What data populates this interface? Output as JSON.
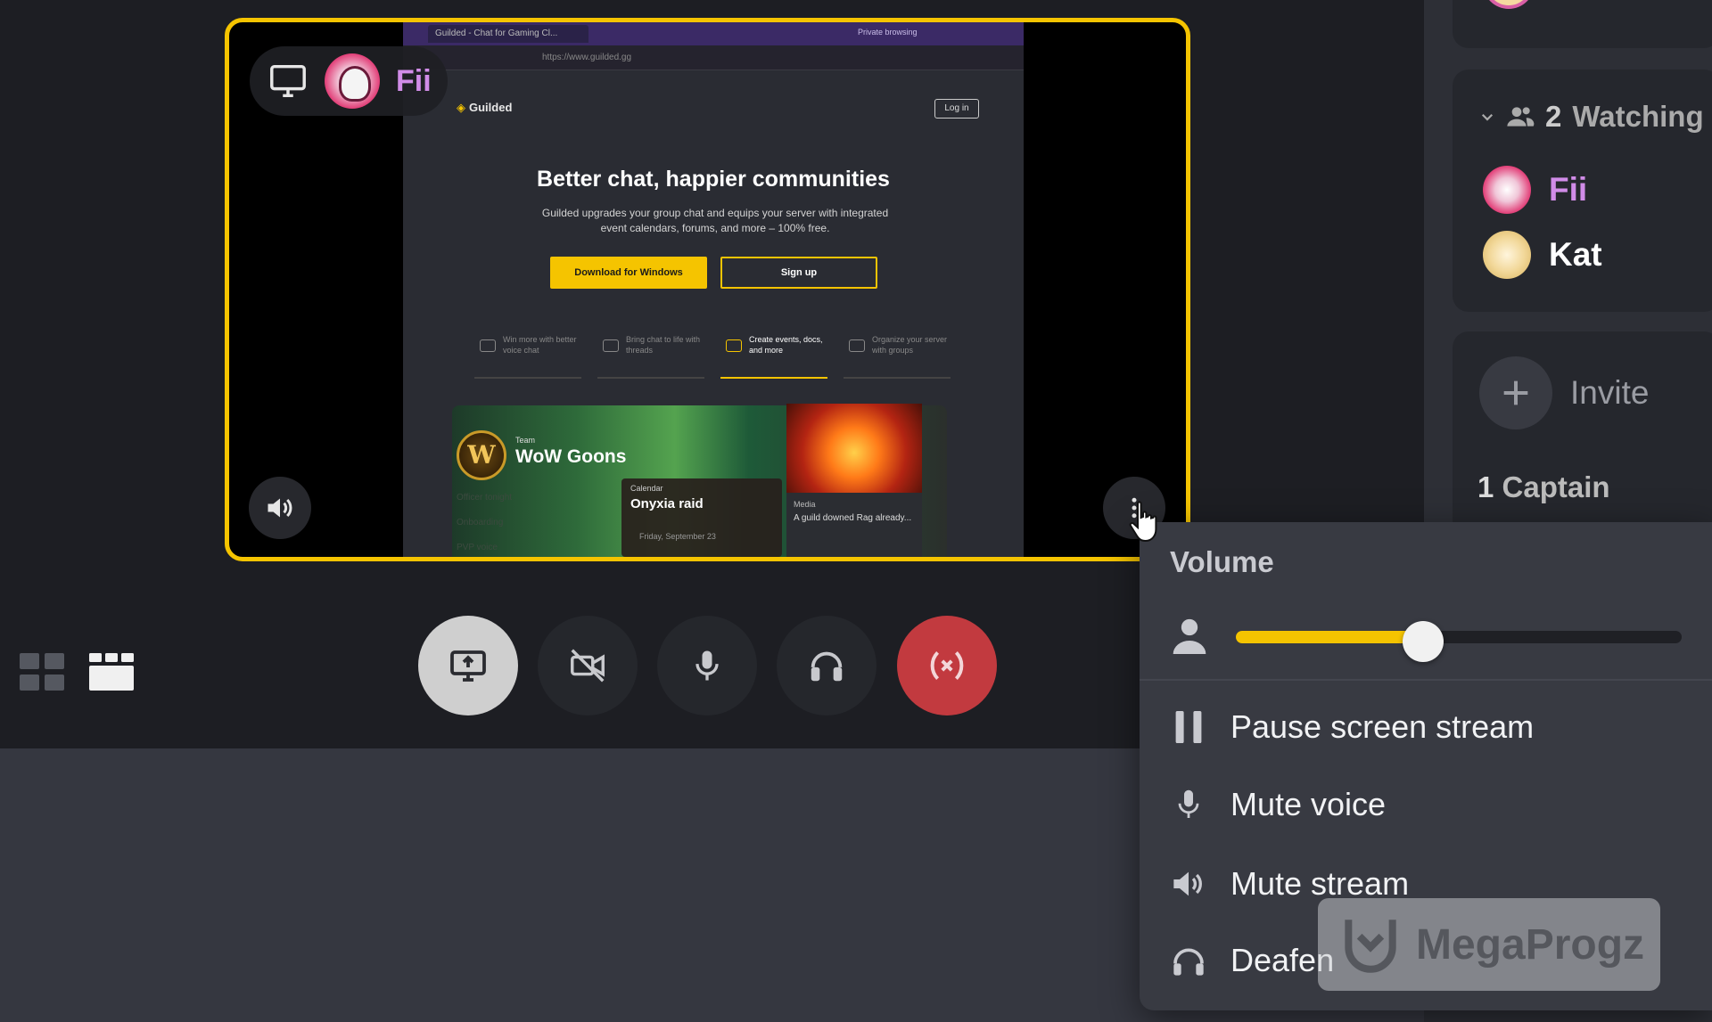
{
  "stream": {
    "streamer_name": "Fii",
    "browser_tab_title": "Guilded - Chat for Gaming Cl...",
    "browser_private_label": "Private browsing",
    "browser_url": "https://www.guilded.gg",
    "site": {
      "logo_text": "Guilded",
      "login_label": "Log in",
      "hero_title": "Better chat, happier communities",
      "hero_subtitle": "Guilded upgrades your group chat and equips your server with integrated event calendars, forums, and more – 100% free.",
      "primary_cta": "Download for Windows",
      "secondary_cta": "Sign up",
      "features": [
        "Win more with better voice chat",
        "Bring chat to life with threads",
        "Create events, docs, and more",
        "Organize your server with groups"
      ],
      "team_label": "Team",
      "team_name": "WoW Goons",
      "emblem_letter": "W",
      "faint_items": [
        "Officer tonight",
        "Onboarding",
        "PVP voice"
      ],
      "event_category": "Calendar",
      "event_title": "Onyxia raid",
      "event_date": "Friday, September 23",
      "media_category": "Media",
      "media_title": "A guild downed Rag already..."
    }
  },
  "controls": {
    "screenshare": "screen-share-icon",
    "camera": "camera-off-icon",
    "mic": "microphone-icon",
    "headset": "headset-icon",
    "leave": "leave-call-icon",
    "accent_leave": "#c23a3f"
  },
  "sidebar": {
    "watching_count": "2",
    "watching_label": "Watching",
    "viewers": [
      {
        "name": "Fii",
        "color": "#d18ce8"
      },
      {
        "name": "Kat",
        "color": "#ffffff"
      }
    ],
    "invite_label": "Invite",
    "captain_count": "1",
    "captain_label": "Captain"
  },
  "menu": {
    "header": "Volume",
    "volume_level": 0.42,
    "items": [
      {
        "label": "Pause screen stream",
        "icon": "pause-icon"
      },
      {
        "label": "Mute voice",
        "icon": "microphone-icon"
      },
      {
        "label": "Mute stream",
        "icon": "speaker-icon"
      },
      {
        "label": "Deafen",
        "icon": "headphones-icon"
      }
    ]
  },
  "watermark": {
    "text": "MegaProgz"
  },
  "colors": {
    "accent": "#f5c400",
    "background": "#1d1e23",
    "menu_bg": "#383a42"
  }
}
